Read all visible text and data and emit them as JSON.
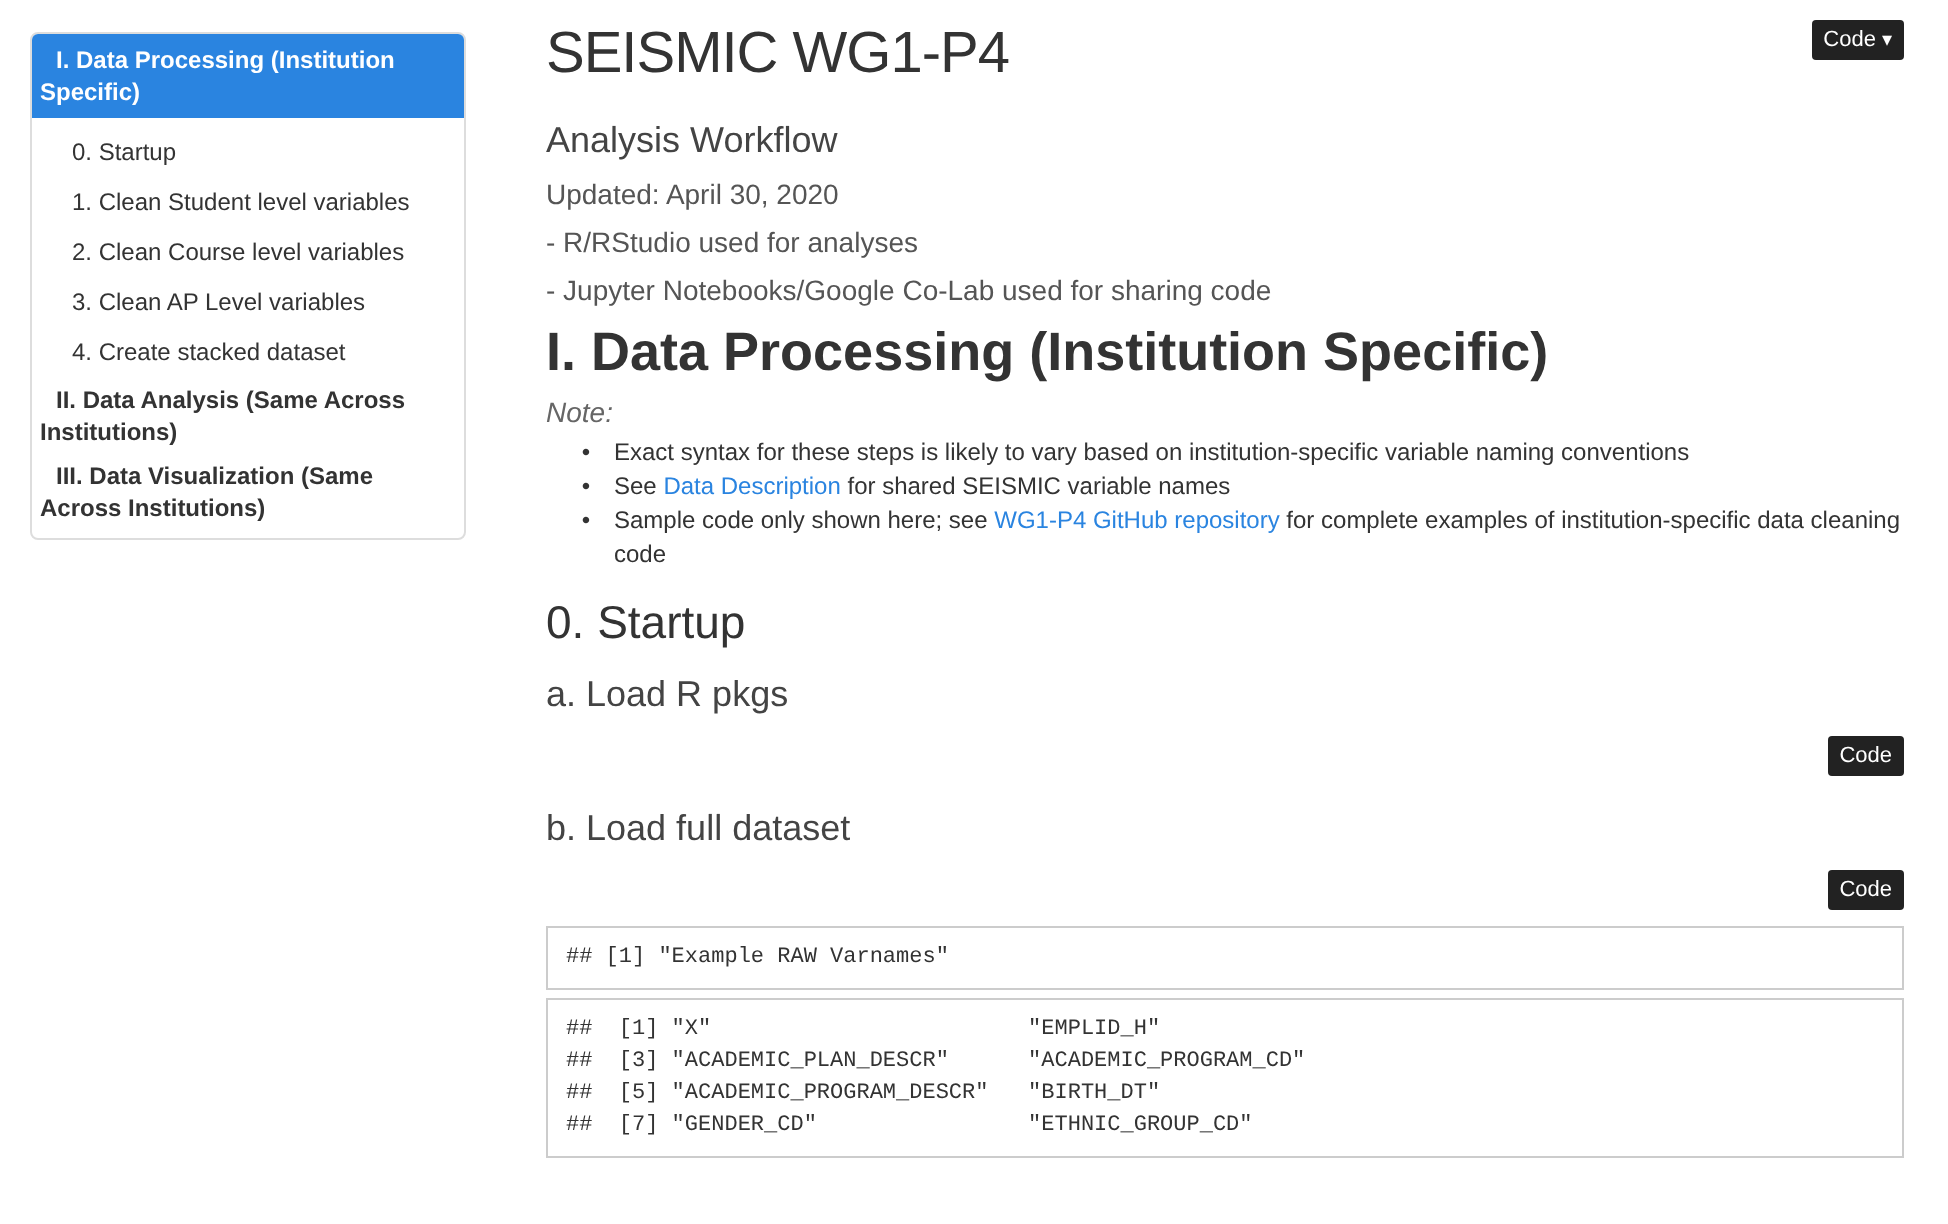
{
  "toc": {
    "items": [
      {
        "label": "I. Data Processing (Institution Specific)",
        "selected": true,
        "children": [
          {
            "label": "0. Startup",
            "selected": false
          },
          {
            "label": "1. Clean Student level variables",
            "selected": false
          },
          {
            "label": "2. Clean Course level variables",
            "selected": false
          },
          {
            "label": "3. Clean AP Level variables",
            "selected": false
          },
          {
            "label": "4. Create stacked dataset",
            "selected": false
          }
        ]
      },
      {
        "label": "II. Data Analysis (Same Across Institutions)",
        "selected": false
      },
      {
        "label": "III. Data Visualization (Same Across Institutions)",
        "selected": false
      }
    ]
  },
  "code_menu": {
    "label": "Code",
    "caret": "▾"
  },
  "title": "SEISMIC WG1-P4",
  "subtitle": "Analysis Workflow",
  "meta": [
    "Updated: April 30, 2020",
    "- R/RStudio used for analyses",
    "- Jupyter Notebooks/Google Co-Lab used for sharing code"
  ],
  "section": {
    "heading": "I. Data Processing (Institution Specific)",
    "note": "Note:",
    "bullets": [
      {
        "marker": "•",
        "parts": [
          {
            "kind": "text",
            "text": "Exact syntax for these steps is likely to vary based on institution-specific variable naming conventions"
          }
        ]
      },
      {
        "marker": "•",
        "parts": [
          {
            "kind": "text",
            "text": "See "
          },
          {
            "kind": "link",
            "text": "Data Description"
          },
          {
            "kind": "text",
            "text": " for shared SEISMIC variable names"
          }
        ]
      },
      {
        "marker": "•",
        "parts": [
          {
            "kind": "text",
            "text": "Sample code only shown here; see "
          },
          {
            "kind": "link",
            "text": "WG1-P4 GitHub repository"
          },
          {
            "kind": "text",
            "text": " for complete examples of institution-specific data cleaning code"
          }
        ]
      }
    ]
  },
  "blocks": [
    {
      "kind": "h2",
      "text": "0. Startup"
    },
    {
      "kind": "h3",
      "text": "a. Load R pkgs"
    },
    {
      "kind": "code_button",
      "text": "Code"
    },
    {
      "kind": "h3",
      "text": "b. Load full dataset"
    },
    {
      "kind": "code_button",
      "text": "Code"
    },
    {
      "kind": "output",
      "lines": [
        "## [1] \"Example RAW Varnames\""
      ]
    },
    {
      "kind": "output",
      "lines": [
        "##  [1] \"X\"                        \"EMPLID_H\"",
        "##  [3] \"ACADEMIC_PLAN_DESCR\"      \"ACADEMIC_PROGRAM_CD\"",
        "##  [5] \"ACADEMIC_PROGRAM_DESCR\"   \"BIRTH_DT\"",
        "##  [7] \"GENDER_CD\"                \"ETHNIC_GROUP_CD\""
      ]
    }
  ]
}
